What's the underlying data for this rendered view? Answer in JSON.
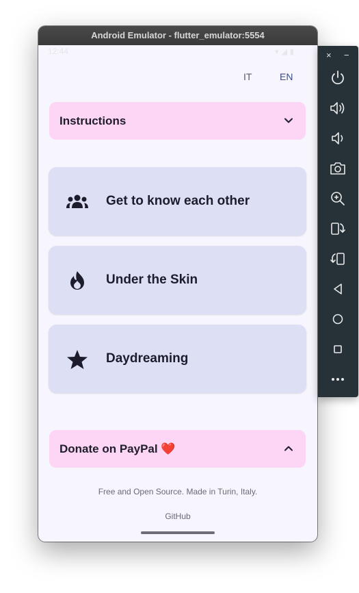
{
  "window": {
    "title": "Android Emulator - flutter_emulator:5554"
  },
  "status_bar": {
    "time": "12:44"
  },
  "language": {
    "it": "IT",
    "en": "EN"
  },
  "instructions": {
    "label": "Instructions",
    "icon": "chevron-down-icon"
  },
  "categories": [
    {
      "label": "Get to know each other",
      "icon": "people-group-icon"
    },
    {
      "label": "Under the Skin",
      "icon": "flame-icon"
    },
    {
      "label": "Daydreaming",
      "icon": "star-icon"
    }
  ],
  "donate": {
    "label": "Donate on PayPal ❤️",
    "icon": "chevron-up-icon"
  },
  "footer": {
    "tagline": "Free and Open Source. Made in Turin, Italy.",
    "github": "GitHub"
  },
  "toolbar": {
    "close": "×",
    "minimize": "−",
    "buttons": [
      "power-icon",
      "volume-up-icon",
      "volume-down-icon",
      "camera-icon",
      "zoom-icon",
      "rotate-left-icon",
      "rotate-right-icon",
      "back-icon",
      "home-icon",
      "overview-icon",
      "more-icon"
    ]
  },
  "colors": {
    "accent_panel": "#fcd6f4",
    "card": "#dde0f5",
    "toolbar": "#263238"
  }
}
